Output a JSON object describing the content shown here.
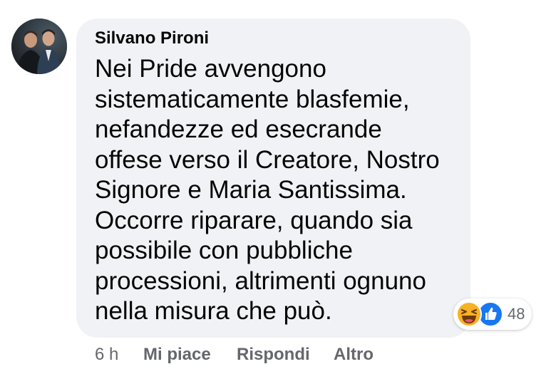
{
  "comment": {
    "author": "Silvano Pironi",
    "text": "Nei Pride avvengono\nsistematicamente blasfemie,\nnefandezze ed esecrande\noffese verso il Creatore, Nostro\nSignore e Maria Santissima.\nOccorre riparare, quando sia\npossibile con pubbliche\nprocessioni, altrimenti ognuno\nnella misura che può.",
    "reactions": {
      "icons": [
        "haha-icon",
        "like-icon"
      ],
      "count": "48"
    },
    "actions": {
      "time": "6 h",
      "like": "Mi piace",
      "reply": "Rispondi",
      "more": "Altro"
    }
  },
  "colors": {
    "bubble_bg": "#f0f2f5",
    "text": "#050505",
    "secondary_text": "#65676b",
    "like_blue": "#1877f2",
    "haha_yellow": "#f7b125"
  }
}
